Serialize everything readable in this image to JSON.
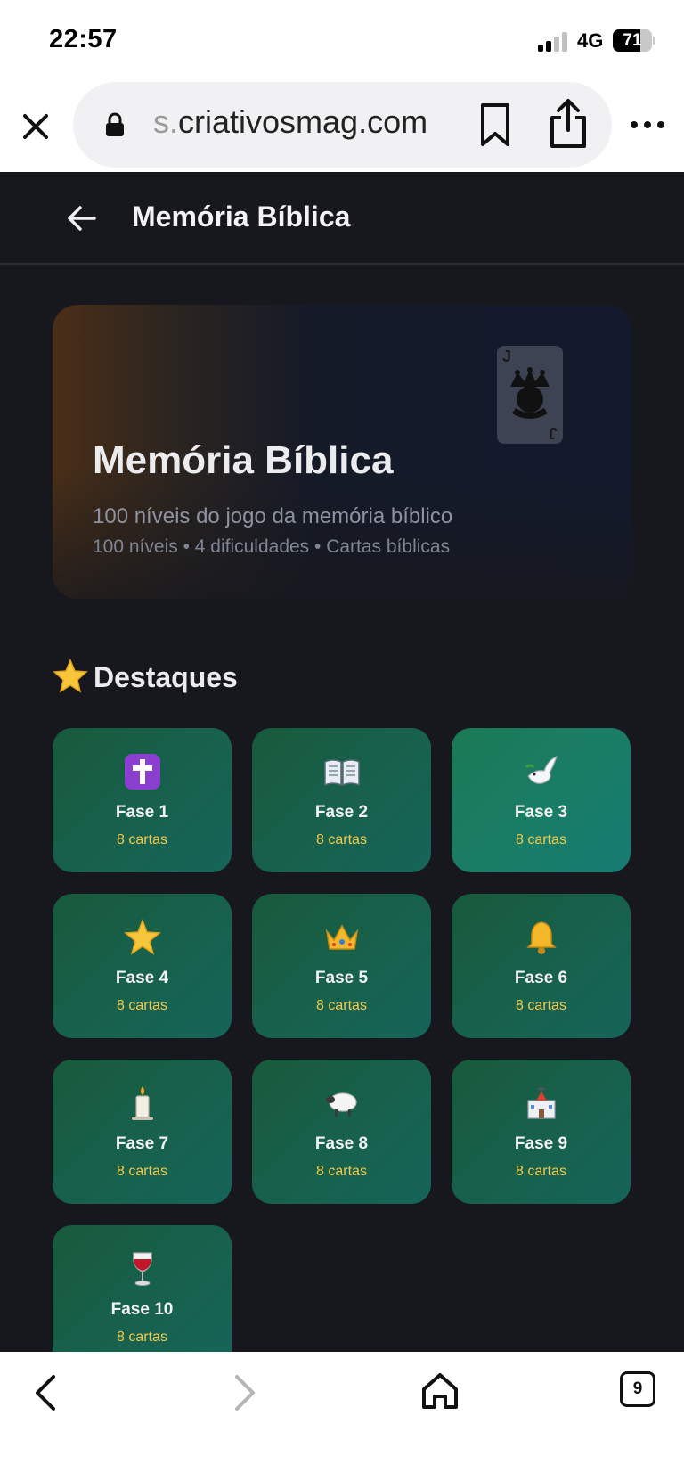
{
  "status_bar": {
    "time": "22:57",
    "network": "4G",
    "battery": "71",
    "battery_level": 0.71
  },
  "browser": {
    "url_faded": "s.",
    "url_main": "criativosmag.com",
    "icons": {
      "close": "close-icon",
      "lock": "lock-icon",
      "bookmark": "bookmark-icon",
      "share": "share-icon",
      "more": "more-icon"
    }
  },
  "app_header": {
    "title": "Memória Bíblica",
    "back_icon": "arrow-left-icon"
  },
  "hero": {
    "title": "Memória Bíblica",
    "subtitle": "100 níveis do jogo da memória bíblico",
    "meta": "100 níveis • 4 dificuldades • Cartas bíblicas",
    "card_rank": "J",
    "card_icon": "joker-icon"
  },
  "section": {
    "title": "Destaques",
    "icon": "star-icon"
  },
  "levels": [
    {
      "name": "Fase 1",
      "count": "8 cartas",
      "icon": "cross-icon"
    },
    {
      "name": "Fase 2",
      "count": "8 cartas",
      "icon": "open-book-icon"
    },
    {
      "name": "Fase 3",
      "count": "8 cartas",
      "icon": "dove-icon"
    },
    {
      "name": "Fase 4",
      "count": "8 cartas",
      "icon": "star-icon"
    },
    {
      "name": "Fase 5",
      "count": "8 cartas",
      "icon": "crown-icon"
    },
    {
      "name": "Fase 6",
      "count": "8 cartas",
      "icon": "bell-icon"
    },
    {
      "name": "Fase 7",
      "count": "8 cartas",
      "icon": "candle-icon"
    },
    {
      "name": "Fase 8",
      "count": "8 cartas",
      "icon": "sheep-icon"
    },
    {
      "name": "Fase 9",
      "count": "8 cartas",
      "icon": "church-icon"
    },
    {
      "name": "Fase 10",
      "count": "8 cartas",
      "icon": "wine-glass-icon"
    }
  ],
  "toolbar": {
    "tabs_count": "9"
  },
  "colors": {
    "page_bg": "#17181d",
    "tile": "#17614d",
    "tile_count": "#f2c94c",
    "status_text": "#000000"
  }
}
